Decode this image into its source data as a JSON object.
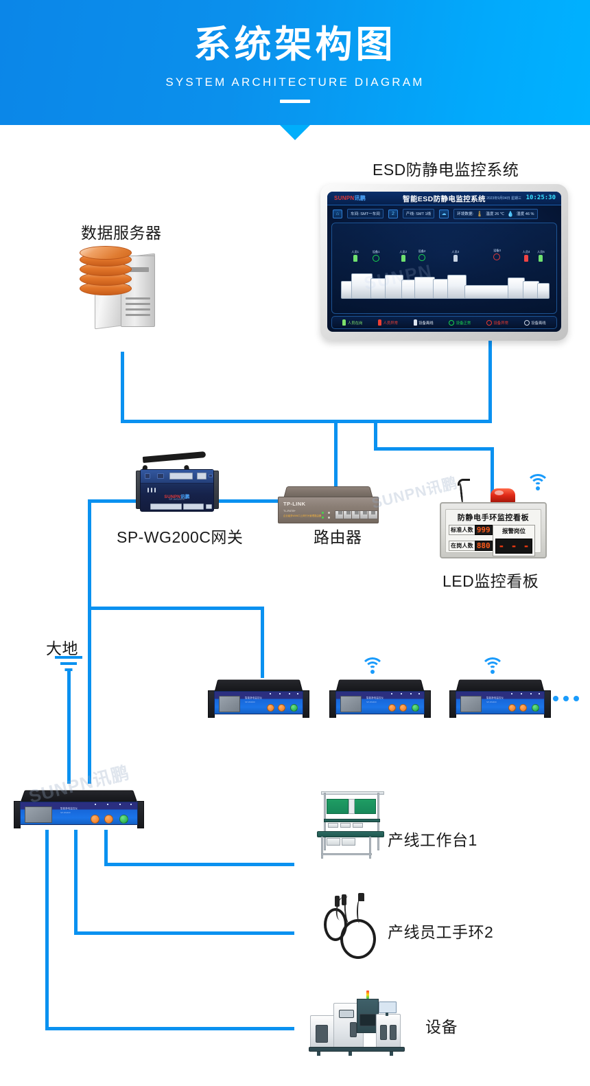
{
  "header": {
    "title": "系统架构图",
    "subtitle": "SYSTEM ARCHITECTURE DIAGRAM"
  },
  "nodes": {
    "server_label": "数据服务器",
    "monitor_label": "ESD防静电监控系统",
    "gateway_label": "SP-WG200C网关",
    "router_label": "路由器",
    "ledboard_label": "LED监控看板",
    "ground_label": "大地",
    "workbench_label": "产线工作台1",
    "wriststrap_label": "产线员工手环2",
    "equipment_label": "设备"
  },
  "monitor_screen": {
    "logo_main": "SUNPN",
    "logo_cn": "讯鹏",
    "title": "智能ESD防静电监控系统",
    "date": "2023年9月04日 星期三",
    "time": "10:25:30",
    "info": [
      {
        "icon": "workshop-icon",
        "label": "车间: SMT一车间"
      },
      {
        "icon": "line-icon",
        "label": "产线: SMT 1线"
      },
      {
        "icon": "env-icon",
        "label": "环境数据:"
      }
    ],
    "temperature": "温度 26 ℃",
    "humidity": "湿度 46 %",
    "watermark": "SUNPN",
    "markers": [
      {
        "label": "人员1",
        "type": "person",
        "color": "#6fe06f"
      },
      {
        "label": "设备1",
        "type": "device",
        "color": "#19d94f"
      },
      {
        "label": "人员2",
        "type": "person",
        "color": "#6fe06f"
      },
      {
        "label": "设备2",
        "type": "device",
        "color": "#19d94f"
      },
      {
        "label": "人员3",
        "type": "person",
        "color": "#c8d4e4"
      },
      {
        "label": "设备3",
        "type": "device",
        "color": "#e33a3a"
      },
      {
        "label": "人员4",
        "type": "person",
        "color": "#ef4444"
      },
      {
        "label": "人员5",
        "type": "person",
        "color": "#6fe06f"
      }
    ],
    "legend": [
      {
        "label": "人员在岗",
        "shape": "person",
        "color": "#7ee06a"
      },
      {
        "label": "人员异常",
        "shape": "person",
        "color": "#ef4034"
      },
      {
        "label": "设备离线",
        "shape": "person",
        "color": "#dfe6f0"
      },
      {
        "label": "设备正常",
        "shape": "ring",
        "color": "#19d94f"
      },
      {
        "label": "设备异常",
        "shape": "ring",
        "color": "#ef3b2f"
      },
      {
        "label": "设备离线",
        "shape": "ring",
        "color": "#cfd8e6"
      }
    ]
  },
  "ledboard": {
    "title": "防静电手环监控看板",
    "rows": [
      {
        "key": "标准人数",
        "value": "999"
      },
      {
        "key": "在岗人数",
        "value": "880"
      }
    ],
    "alarm_title": "报警岗位",
    "alarm_value": "- - -"
  },
  "gateway": {
    "brand": "SUNPN",
    "brand_cn": "讯鹏",
    "model": "SP-WG200C"
  },
  "router": {
    "brand": "TP-LINK",
    "model": "TL-R478+",
    "sub": "企业级多WAN口上网行为管理路由器"
  },
  "esd_boxes": [
    {
      "brand": "智能静电监控仪",
      "model": "SP-DM400"
    },
    {
      "brand": "智能静电监控仪",
      "model": "SP-DM400"
    },
    {
      "brand": "智能静电监控仪",
      "model": "SP-DM400"
    },
    {
      "brand": "智能静电监控仪",
      "model": "SP-DM400"
    }
  ],
  "watermarks": {
    "w1": "SUNPN讯鹏",
    "w2": "SUNPN讯鹏",
    "w3": "SUNPN讯鹏"
  },
  "colors": {
    "header_blue": "#0b90ec",
    "header_blue_light": "#00b2ff",
    "line_blue": "#0a91f0",
    "wifi_blue": "#1a9bfb",
    "led_digit": "#ff5a18"
  }
}
